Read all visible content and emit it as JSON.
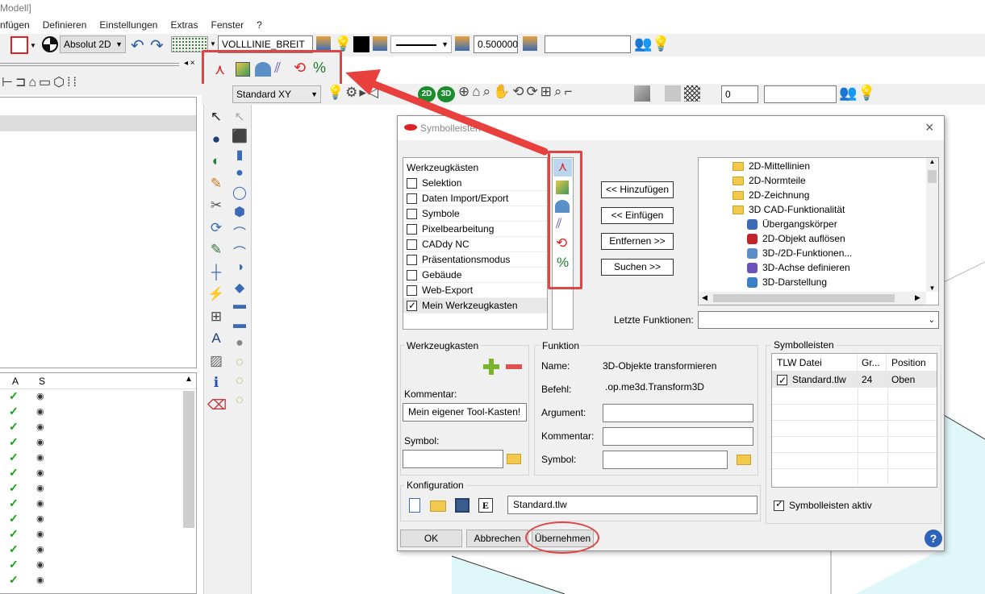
{
  "title": "Modell]",
  "menu": [
    "nfügen",
    "Definieren",
    "Einstellungen",
    "Extras",
    "Fenster",
    "?"
  ],
  "toolbar1": {
    "view_mode": "Absolut 2D",
    "linetype": "VOLLLINIE_BREIT",
    "line_width": "0.500000",
    "empty_field": ""
  },
  "toolbar2": {
    "view": "Standard XY",
    "number": "0"
  },
  "left_list": {
    "columns": [
      "A",
      "S"
    ],
    "row_count": 13
  },
  "dialog": {
    "title": "Symbolleisten",
    "toolbox_header": "Werkzeugkästen",
    "toolboxes": [
      {
        "label": "Selektion",
        "checked": false
      },
      {
        "label": "Daten Import/Export",
        "checked": false
      },
      {
        "label": "Symbole",
        "checked": false
      },
      {
        "label": "Pixelbearbeitung",
        "checked": false
      },
      {
        "label": "CADdy NC",
        "checked": false
      },
      {
        "label": "Präsentationsmodus",
        "checked": false
      },
      {
        "label": "Gebäude",
        "checked": false
      },
      {
        "label": "Web-Export",
        "checked": false
      },
      {
        "label": "Mein Werkzeugkasten",
        "checked": true
      }
    ],
    "buttons": {
      "add": "<< Hinzufügen",
      "insert": "<< Einfügen",
      "remove": "Entfernen >>",
      "search": "Suchen >>"
    },
    "tree": [
      {
        "label": "2D-Mittellinien",
        "type": "folder"
      },
      {
        "label": "2D-Normteile",
        "type": "folder"
      },
      {
        "label": "2D-Zeichnung",
        "type": "folder"
      },
      {
        "label": "3D CAD-Funktionalität",
        "type": "folder"
      },
      {
        "label": "Übergangskörper",
        "type": "item"
      },
      {
        "label": "2D-Objekt auflösen",
        "type": "item"
      },
      {
        "label": "3D-/2D-Funktionen...",
        "type": "item"
      },
      {
        "label": "3D-Achse definieren",
        "type": "item"
      },
      {
        "label": "3D-Darstellung",
        "type": "item"
      }
    ],
    "last_functions_label": "Letzte Funktionen:",
    "last_functions_value": "",
    "werkzeugkasten": {
      "label": "Werkzeugkasten",
      "comment_label": "Kommentar:",
      "comment_value": "Mein eigener Tool-Kasten!",
      "symbol_label": "Symbol:",
      "symbol_value": ""
    },
    "funktion": {
      "label": "Funktion",
      "name_label": "Name:",
      "name_value": "3D-Objekte transformieren",
      "command_label": "Befehl:",
      "command_value": ".op.me3d.Transform3D",
      "argument_label": "Argument:",
      "argument_value": "",
      "comment_label": "Kommentar:",
      "comment_value": "",
      "symbol_label": "Symbol:",
      "symbol_value": ""
    },
    "symbolleisten": {
      "label": "Symbolleisten",
      "columns": [
        "TLW Datei",
        "Gr...",
        "Position"
      ],
      "rows": [
        {
          "file": "Standard.tlw",
          "size": "24",
          "position": "Oben",
          "checked": true
        }
      ],
      "active_label": "Symbolleisten aktiv",
      "active_checked": true
    },
    "konfiguration": {
      "label": "Konfiguration",
      "file_value": "Standard.tlw"
    },
    "footer": {
      "ok": "OK",
      "cancel": "Abbrechen",
      "apply": "Übernehmen"
    }
  },
  "colors": {
    "highlight_red": "#e04545",
    "arrow_red": "#e8413d",
    "cyan_area": "#dff7f9"
  }
}
